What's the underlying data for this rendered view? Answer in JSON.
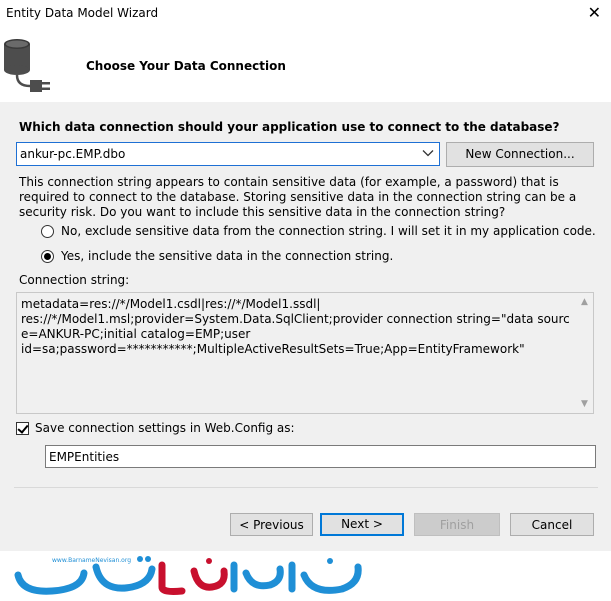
{
  "window": {
    "title": "Entity Data Model Wizard",
    "close_glyph": "✕"
  },
  "header": {
    "title": "Choose Your Data Connection",
    "icon": "database-plug-icon"
  },
  "question": "Which data connection should your application use to connect to the database?",
  "connection_select": {
    "value": "ankur-pc.EMP.dbo"
  },
  "new_connection_label": "New Connection...",
  "sensitive_text": "This connection string appears to contain sensitive data (for example, a password) that is required to connect to the database. Storing sensitive data in the connection string can be a security risk. Do you want to include this sensitive data in the connection string?",
  "radio_options": [
    {
      "label": "No, exclude sensitive data from the connection string. I will set it in my application code.",
      "selected": false
    },
    {
      "label": "Yes, include the sensitive data in the connection string.",
      "selected": true
    }
  ],
  "connection_string_label": "Connection string:",
  "connection_string": "metadata=res://*/Model1.csdl|res://*/Model1.ssdl|\nres://*/Model1.msl;provider=System.Data.SqlClient;provider connection string=\"data source=ANKUR-PC;initial catalog=EMP;user\nid=sa;password=***********;MultipleActiveResultSets=True;App=EntityFramework\"",
  "save_checkbox": {
    "label": "Save connection settings in Web.Config as:",
    "checked": true
  },
  "entities_name": "EMPEntities",
  "buttons": {
    "previous": "< Previous",
    "next": "Next >",
    "finish": "Finish",
    "cancel": "Cancel"
  },
  "watermark": {
    "url": "www.BarnameNevisan.org",
    "brand": "برنامه نویسان"
  },
  "colors": {
    "focus": "#0078d7",
    "content_bg": "#f0f0f0",
    "logo_blue": "#1f8fd6",
    "logo_red": "#c8102e"
  }
}
